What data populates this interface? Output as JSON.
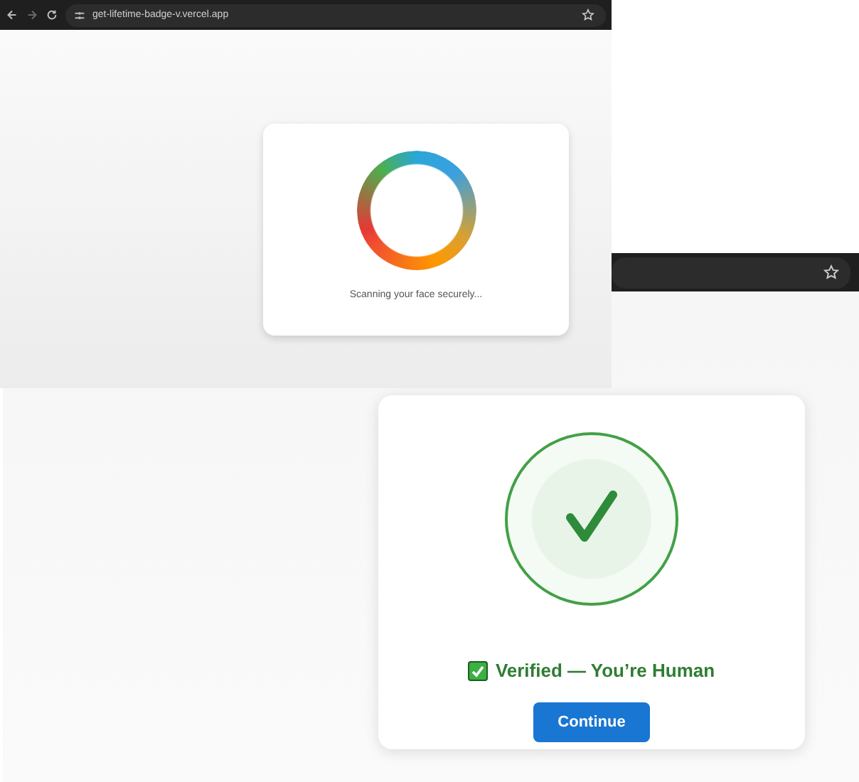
{
  "windows": [
    {
      "kind": "scanning",
      "url": "get-lifetime-badge-v.vercel.app",
      "message": "Scanning your face securely..."
    },
    {
      "kind": "verified",
      "status": "Verified — You’re Human",
      "button": "Continue"
    }
  ]
}
